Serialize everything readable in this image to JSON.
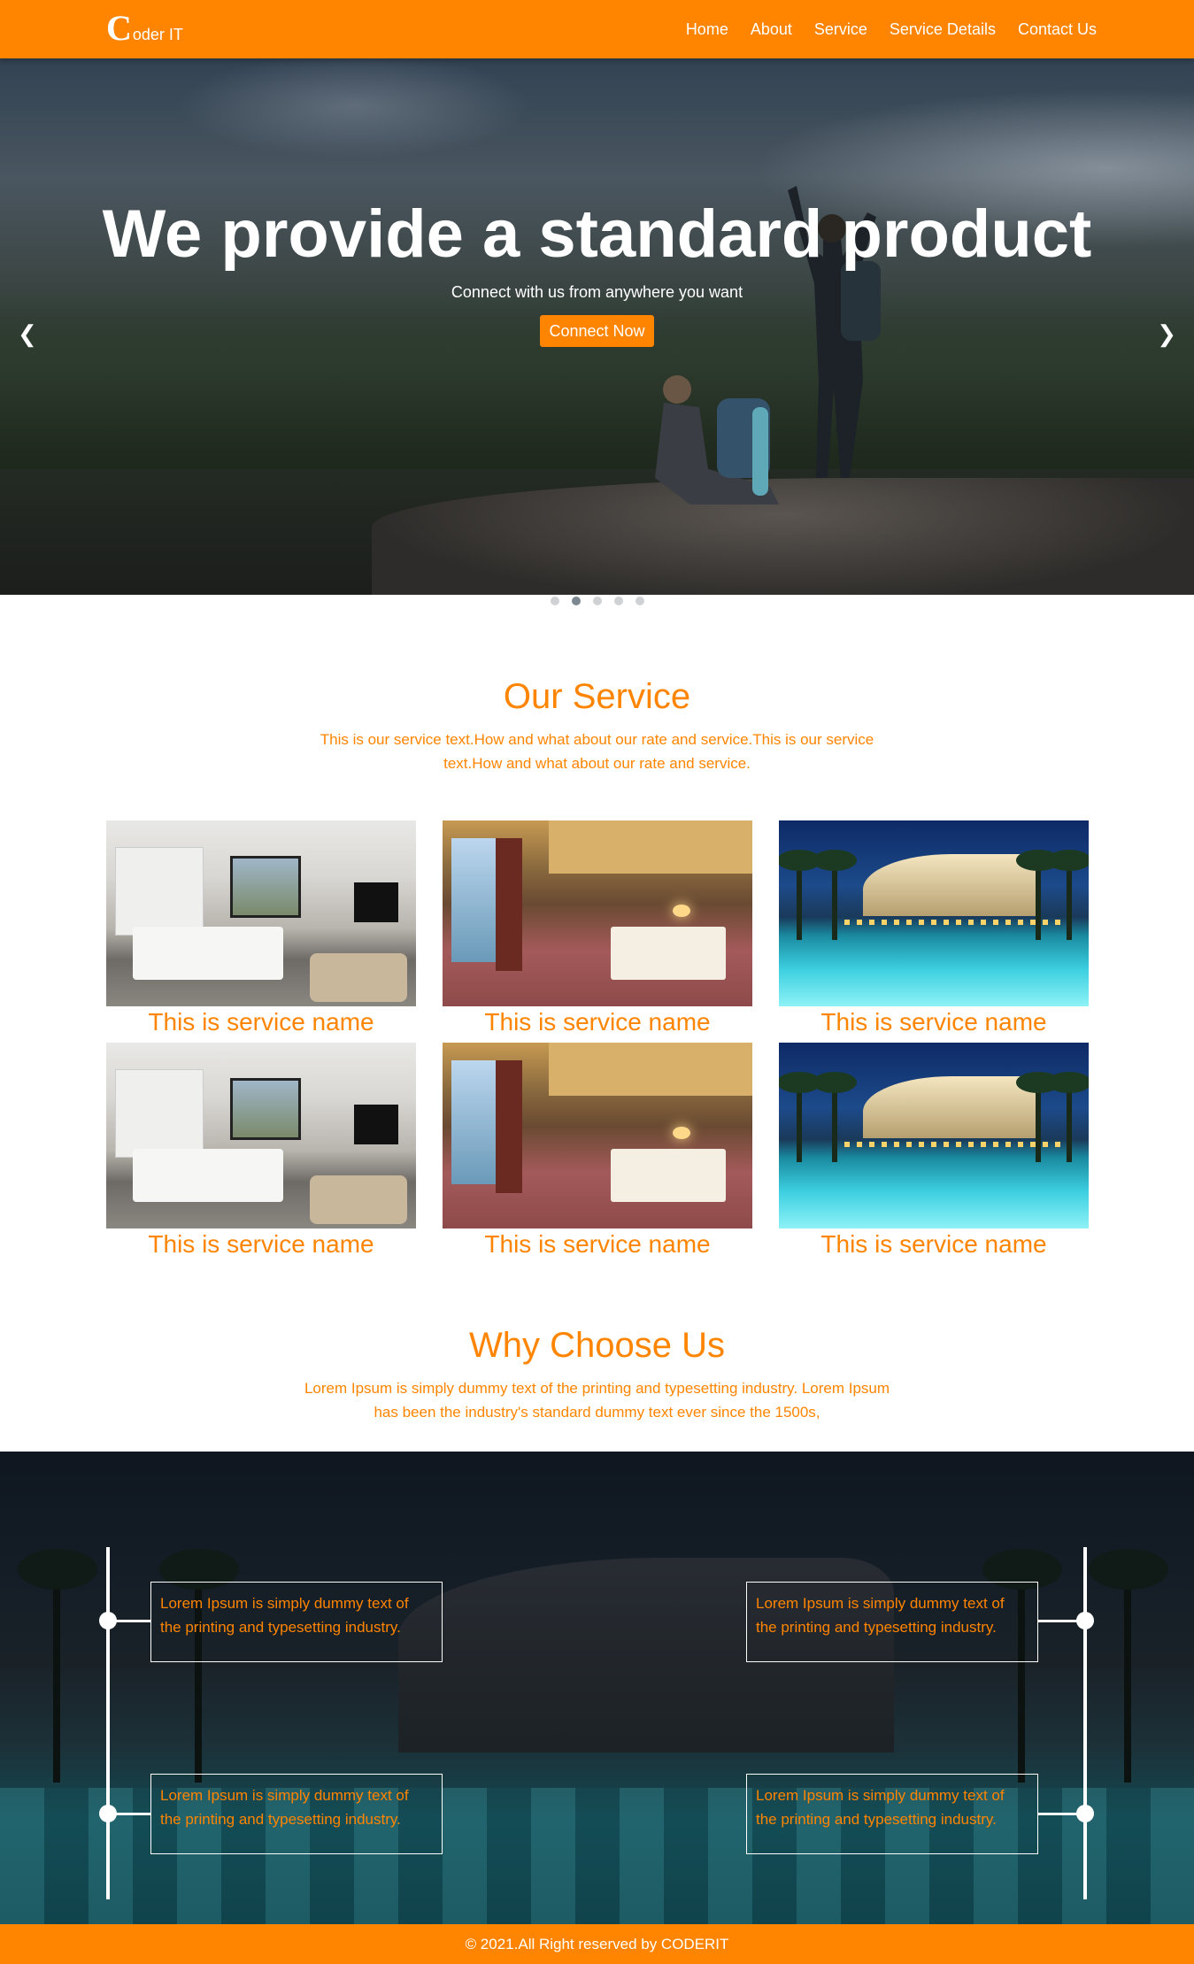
{
  "navbar": {
    "brand_initial": "C",
    "brand_rest": "oder IT",
    "links": [
      "Home",
      "About",
      "Service",
      "Service Details",
      "Contact Us"
    ]
  },
  "hero": {
    "title": "We provide a standard product",
    "subtitle": "Connect with us from anywhere you want",
    "button": "Connect Now",
    "prev_arrow": "❮",
    "next_arrow": "❯",
    "slide_count": 5,
    "active_slide": 2
  },
  "service": {
    "title": "Our Service",
    "text": "This is our service text.How and what about our rate and service.This is our service text.How and what about our rate and service.",
    "cards": [
      {
        "name": "This is service name",
        "image": "modern-hotel-room"
      },
      {
        "name": "This is service name",
        "image": "warm-hotel-room"
      },
      {
        "name": "This is service name",
        "image": "resort-pool-night"
      },
      {
        "name": "This is service name",
        "image": "modern-hotel-room"
      },
      {
        "name": "This is service name",
        "image": "warm-hotel-room"
      },
      {
        "name": "This is service name",
        "image": "resort-pool-night"
      }
    ]
  },
  "why": {
    "title": "Why Choose Us",
    "text": "Lorem Ipsum is simply dummy text of the printing and typesetting industry. Lorem Ipsum has been the industry's standard dummy text ever since the 1500s,",
    "items": [
      "Lorem Ipsum is simply dummy text of the printing and typesetting industry.",
      "Lorem Ipsum is simply dummy text of the printing and typesetting industry.",
      "Lorem Ipsum is simply dummy text of the printing and typesetting industry.",
      "Lorem Ipsum is simply dummy text of the printing and typesetting industry."
    ]
  },
  "footer": {
    "text": "© 2021.All Right reserved by CODERIT"
  },
  "colors": {
    "accent": "#ff8400",
    "white": "#ffffff"
  }
}
